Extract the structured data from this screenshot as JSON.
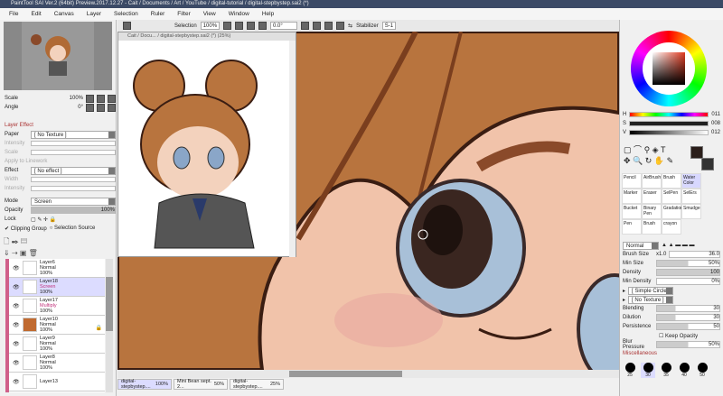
{
  "title": "PaintTool SAI Ver.2 (64bit) Preview.2017.12.27 - Cait / Documents / Art / YouTube / digital-tutorial / digital-stepbystep.sai2 (*)",
  "menu": [
    "File",
    "Edit",
    "Canvas",
    "Layer",
    "Selection",
    "Ruler",
    "Filter",
    "View",
    "Window",
    "Help"
  ],
  "toolbar": {
    "selection": "Selection",
    "zoom": "100%",
    "angle": "0.0°",
    "stabilizer_label": "Stabilizer",
    "stabilizer": "S-1"
  },
  "subwindow": {
    "title": "Cait / Docu... / digital-stepbystep.sai2 (*) (25%)"
  },
  "left": {
    "scale_label": "Scale",
    "scale": "100%",
    "angle_label": "Angle",
    "angle": "0°",
    "layer_effect": "Layer Effect",
    "paper_label": "Paper",
    "paper": "[ No Texture ]",
    "intensity": "Intensity",
    "scale2": "Scale",
    "apply": "Apply to Linework",
    "effect_label": "Effect",
    "effect": "[ No effect ]",
    "width": "Width",
    "intensity2": "Intensity",
    "mode_label": "Mode",
    "mode": "Screen",
    "opacity_label": "Opacity",
    "opacity": "100%",
    "opacity_value": 100,
    "lock_label": "Lock",
    "clipping": "Clipping Group",
    "selection_source": "Selection Source",
    "layers": [
      {
        "name": "Layer6",
        "mode": "Normal",
        "opacity": "100%"
      },
      {
        "name": "Layer18",
        "mode": "Screen",
        "opacity": "100%",
        "selected": true
      },
      {
        "name": "Layer17",
        "mode": "Multiply",
        "opacity": "100%"
      },
      {
        "name": "Layer10",
        "mode": "Normal",
        "opacity": "100%"
      },
      {
        "name": "Layer9",
        "mode": "Normal",
        "opacity": "100%"
      },
      {
        "name": "Layer8",
        "mode": "Normal",
        "opacity": "100%"
      },
      {
        "name": "Layer13",
        "mode": "",
        "opacity": ""
      }
    ]
  },
  "right": {
    "h_label": "H",
    "h": "011",
    "s_label": "S",
    "s": "008",
    "v_label": "V",
    "v": "012",
    "primary_color": "#2a1e1a",
    "secondary_color": "#333333",
    "tools": [
      "Pencil",
      "AirBrush",
      "Brush",
      "Water Color",
      "Marker",
      "Eraser",
      "SelPen",
      "SelErs",
      "Bucket",
      "Binary Pen",
      "Gradation",
      "Smudge",
      "Pen",
      "Brush",
      "crayon"
    ],
    "blend_mode": "Normal",
    "brush_size_label": "Brush Size",
    "brush_mult": "x1.0",
    "brush_size": "36.0",
    "min_size_label": "Min Size",
    "min_size": "50%",
    "density_label": "Density",
    "density": "100",
    "min_density_label": "Min Density",
    "min_density": "0%",
    "shape": "[ Simple Circle ]",
    "texture": "[ No Texture ]",
    "blending_label": "Blending",
    "blending": "30",
    "dilution_label": "Dilution",
    "dilution": "30",
    "persistence_label": "Persistence",
    "persistence": "50",
    "keep_opacity": "Keep Opacity",
    "blur_label": "Blur Pressure",
    "blur": "50%",
    "misc": "Miscellaneous",
    "sizes": [
      "25",
      "30",
      "35",
      "40",
      "50"
    ]
  },
  "tabs": [
    {
      "name": "digital-stepbystep....",
      "zoom": "100%",
      "active": true
    },
    {
      "name": "Mini Bean sept. 2...",
      "zoom": "50%"
    },
    {
      "name": "digital-stepbystep....",
      "zoom": "25%"
    }
  ]
}
